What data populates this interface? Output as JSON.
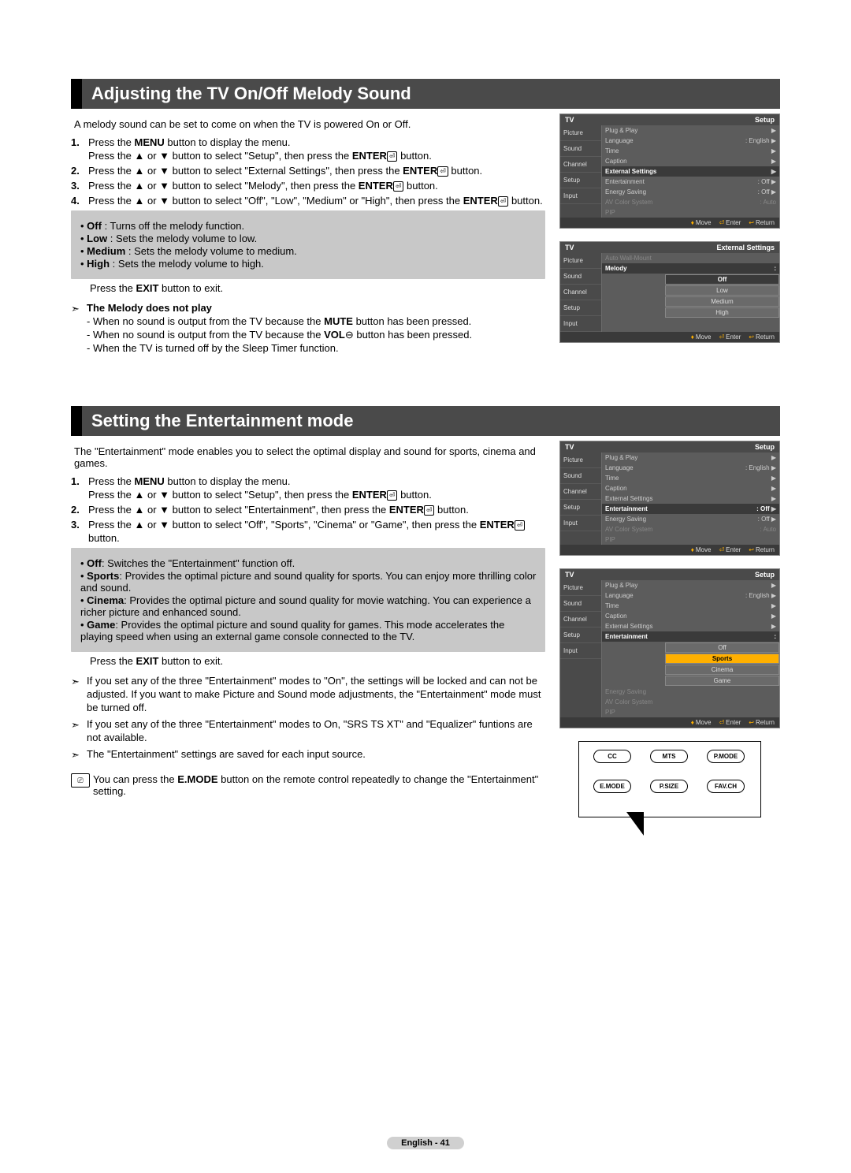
{
  "section1": {
    "title": "Adjusting the TV On/Off Melody Sound",
    "intro": "A melody sound can be set to come on when the TV is powered On or Off.",
    "steps": [
      {
        "num": "1.",
        "lines": [
          "Press the <b>MENU</b> button to display the menu.",
          "Press the ▲ or ▼ button to select \"Setup\", then press the <b>ENTER</b><e/> button."
        ]
      },
      {
        "num": "2.",
        "lines": [
          "Press the ▲ or ▼ button to select \"External Settings\", then press the <b>ENTER</b><e/> button."
        ]
      },
      {
        "num": "3.",
        "lines": [
          "Press the ▲ or ▼ button to select \"Melody\", then press the <b>ENTER</b><e/> button."
        ]
      },
      {
        "num": "4.",
        "lines": [
          "Press the ▲ or ▼ button to select \"Off\", \"Low\", \"Medium\" or \"High\", then press the <b>ENTER</b><e/> button."
        ]
      }
    ],
    "bullets": [
      "<b>Off</b> : Turns off the melody function.",
      "<b>Low</b> : Sets the melody volume to low.",
      "<b>Medium</b> : Sets the melody volume to medium.",
      "<b>High</b> : Sets the melody volume to high."
    ],
    "exit": "Press the <b>EXIT</b> button to exit.",
    "noteTitle": "The Melody does not play",
    "noteItems": [
      "When no sound is output from the TV because the <b>MUTE</b> button has been pressed.",
      "When no sound is output from the TV because the <b>VOL</b>⊖ button has been pressed.",
      "When the TV is turned off by the Sleep Timer function."
    ]
  },
  "section2": {
    "title": "Setting the Entertainment mode",
    "intro": "The \"Entertainment\" mode enables you to select the optimal display and sound for sports, cinema and games.",
    "steps": [
      {
        "num": "1.",
        "lines": [
          "Press the <b>MENU</b> button to display the menu.",
          "Press the ▲ or ▼ button to select \"Setup\", then press the <b>ENTER</b><e/> button."
        ]
      },
      {
        "num": "2.",
        "lines": [
          "Press the ▲ or ▼ button to select \"Entertainment\", then press the <b>ENTER</b><e/> button."
        ]
      },
      {
        "num": "3.",
        "lines": [
          "Press the ▲ or ▼ button to select \"Off\", \"Sports\", \"Cinema\" or \"Game\", then press the <b>ENTER</b><e/> button."
        ]
      }
    ],
    "bullets": [
      "<b>Off</b>: Switches the \"Entertainment\" function off.",
      "<b>Sports</b>: Provides the optimal picture and sound quality for sports. You can enjoy more thrilling color and sound.",
      "<b>Cinema</b>: Provides the optimal picture and sound quality for movie watching. You can experience a richer picture and enhanced sound.",
      "<b>Game</b>: Provides the optimal picture and sound quality for games. This mode accelerates the playing speed when using an external game console connected to the TV."
    ],
    "exit": "Press the <b>EXIT</b> button to exit.",
    "notes": [
      "If you set any of the three \"Entertainment\" modes to \"On\", the settings will be locked and can not be adjusted. If you want to make Picture and Sound mode adjustments, the \"Entertainment\" mode must be turned off.",
      "If you set any of the three \"Entertainment\" modes to On, \"SRS TS XT\" and \"Equalizer\" funtions are not available.",
      "The \"Entertainment\" settings are saved for each input source."
    ],
    "remoteTip": "You can press the <b>E.MODE</b> button on the remote control repeatedly to change the \"Entertainment\" setting."
  },
  "menus": {
    "setup1": {
      "title": "TV",
      "header": "Setup",
      "side": [
        "Picture",
        "Sound",
        "Channel",
        "Setup",
        "Input"
      ],
      "rows": [
        {
          "l": "Plug & Play",
          "r": "",
          "arr": "▶"
        },
        {
          "l": "Language",
          "r": ": English",
          "arr": "▶"
        },
        {
          "l": "Time",
          "r": "",
          "arr": "▶"
        },
        {
          "l": "Caption",
          "r": "",
          "arr": "▶"
        },
        {
          "l": "External Settings",
          "r": "",
          "arr": "▶",
          "h": true
        },
        {
          "l": "Entertainment",
          "r": ": Off",
          "arr": "▶"
        },
        {
          "l": "Energy Saving",
          "r": ": Off",
          "arr": "▶"
        },
        {
          "l": "AV Color System",
          "r": ": Auto",
          "arr": "",
          "muted": true
        },
        {
          "l": "PIP",
          "r": "",
          "arr": "",
          "muted": true
        }
      ],
      "footer": {
        "move": "Move",
        "enter": "Enter",
        "return": "Return"
      }
    },
    "ext": {
      "title": "TV",
      "header": "External Settings",
      "side": [
        "Picture",
        "Sound",
        "Channel",
        "Setup",
        "Input"
      ],
      "rows": [
        {
          "l": "Auto Wall-Mount",
          "r": "",
          "arr": "",
          "muted": true
        },
        {
          "l": "Melody",
          "r": ":",
          "arr": "",
          "h": true
        }
      ],
      "options": [
        "Off",
        "Low",
        "Medium",
        "High"
      ],
      "selected": 0,
      "footer": {
        "move": "Move",
        "enter": "Enter",
        "return": "Return"
      }
    },
    "setup2": {
      "title": "TV",
      "header": "Setup",
      "side": [
        "Picture",
        "Sound",
        "Channel",
        "Setup",
        "Input"
      ],
      "rows": [
        {
          "l": "Plug & Play",
          "r": "",
          "arr": "▶"
        },
        {
          "l": "Language",
          "r": ": English",
          "arr": "▶"
        },
        {
          "l": "Time",
          "r": "",
          "arr": "▶"
        },
        {
          "l": "Caption",
          "r": "",
          "arr": "▶"
        },
        {
          "l": "External Settings",
          "r": "",
          "arr": "▶"
        },
        {
          "l": "Entertainment",
          "r": ": Off",
          "arr": "▶",
          "h": true
        },
        {
          "l": "Energy Saving",
          "r": ": Off",
          "arr": "▶"
        },
        {
          "l": "AV Color System",
          "r": ": Auto",
          "arr": "",
          "muted": true
        },
        {
          "l": "PIP",
          "r": "",
          "arr": "",
          "muted": true
        }
      ],
      "footer": {
        "move": "Move",
        "enter": "Enter",
        "return": "Return"
      }
    },
    "setup3": {
      "title": "TV",
      "header": "Setup",
      "side": [
        "Picture",
        "Sound",
        "Channel",
        "Setup",
        "Input"
      ],
      "rows": [
        {
          "l": "Plug & Play",
          "r": "",
          "arr": "▶"
        },
        {
          "l": "Language",
          "r": ": English",
          "arr": "▶"
        },
        {
          "l": "Time",
          "r": "",
          "arr": "▶"
        },
        {
          "l": "Caption",
          "r": "",
          "arr": "▶"
        },
        {
          "l": "External Settings",
          "r": "",
          "arr": "▶"
        },
        {
          "l": "Entertainment",
          "r": ":",
          "arr": "",
          "h": true
        },
        {
          "l": "Energy Saving",
          "r": "",
          "arr": "",
          "muted": true
        },
        {
          "l": "AV Color System",
          "r": "",
          "arr": "",
          "muted": true
        },
        {
          "l": "PIP",
          "r": "",
          "arr": "",
          "muted": true
        }
      ],
      "options": [
        "Off",
        "Sports",
        "Cinema",
        "Game"
      ],
      "selected": 1,
      "footer": {
        "move": "Move",
        "enter": "Enter",
        "return": "Return"
      }
    }
  },
  "remote": {
    "buttons": [
      "CC",
      "MTS",
      "P.MODE",
      "E.MODE",
      "P.SIZE",
      "FAV.CH"
    ]
  },
  "footer": "English - 41"
}
